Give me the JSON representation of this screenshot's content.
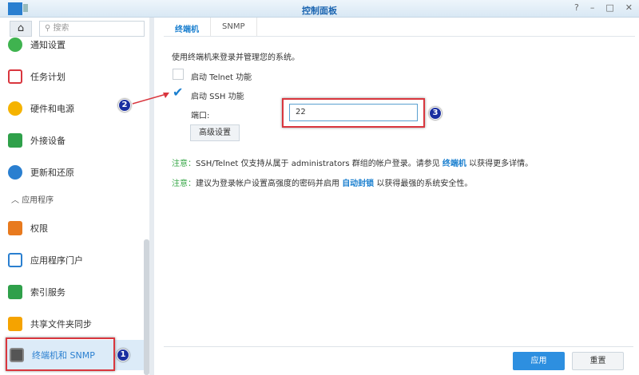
{
  "window": {
    "title": "控制面板",
    "buttons": [
      "?",
      "–",
      "□",
      "✕"
    ]
  },
  "sidebar": {
    "search_placeholder": "搜索",
    "items": [
      {
        "label": "通知设置",
        "color": "#3fb34f"
      },
      {
        "label": "任务计划",
        "color": "#d9363e"
      },
      {
        "label": "硬件和电源",
        "color": "#f5b300"
      },
      {
        "label": "外接设备",
        "color": "#2fa04a"
      },
      {
        "label": "更新和还原",
        "color": "#2a7fd0"
      }
    ],
    "section": "应用程序",
    "items2": [
      {
        "label": "权限",
        "color": "#e87a1e"
      },
      {
        "label": "应用程序门户",
        "color": "#2a7fd0"
      },
      {
        "label": "索引服务",
        "color": "#2fa04a"
      },
      {
        "label": "共享文件夹同步",
        "color": "#f5a300"
      },
      {
        "label": "终端机和 SNMP",
        "color": "#555"
      }
    ]
  },
  "tabs": [
    "终端机",
    "SNMP"
  ],
  "main": {
    "description": "使用终端机来登录并管理您的系统。",
    "telnet_label": "启动 Telnet 功能",
    "telnet_checked": false,
    "ssh_label": "启动 SSH 功能",
    "ssh_checked": true,
    "port_label": "端口:",
    "port_value": "22",
    "advanced_button": "高级设置",
    "note1": {
      "prefix": "注意：",
      "text": "SSH/Telnet 仅支持从属于 administrators 群组的帐户登录。请参见 ",
      "link": "终端机",
      "suffix": " 以获得更多详情。"
    },
    "note2": {
      "prefix": "注意：",
      "text": "建议为登录帐户设置高强度的密码并启用 ",
      "link": "自动封锁",
      "suffix": " 以获得最强的系统安全性。"
    }
  },
  "footer": {
    "apply": "应用",
    "reset": "重置"
  },
  "annotations": [
    "1",
    "2",
    "3"
  ]
}
